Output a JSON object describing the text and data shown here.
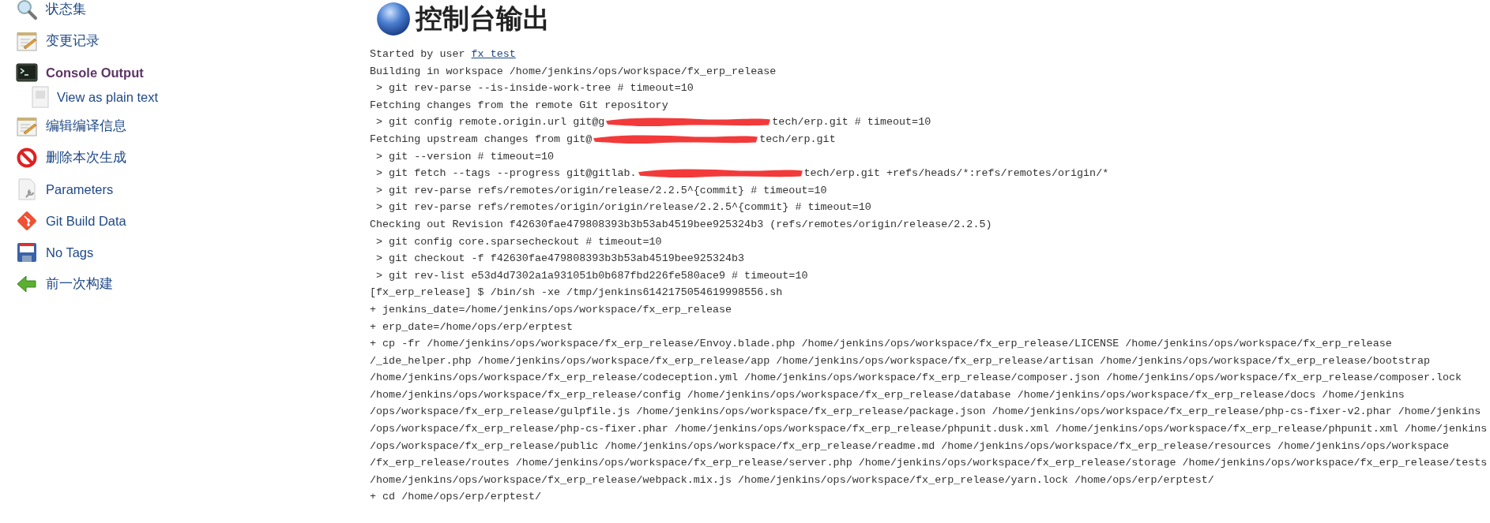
{
  "sidebar": {
    "items": [
      {
        "label": "状态集",
        "kind": "search",
        "selected": false
      },
      {
        "label": "变更记录",
        "kind": "notepad",
        "selected": false
      },
      {
        "label": "Console Output",
        "kind": "console",
        "selected": true,
        "children": [
          {
            "label": "View as plain text",
            "kind": "page",
            "selected": false
          }
        ]
      },
      {
        "label": "编辑编译信息",
        "kind": "notepad",
        "selected": false
      },
      {
        "label": "删除本次生成",
        "kind": "no-entry",
        "selected": false
      },
      {
        "label": "Parameters",
        "kind": "params",
        "selected": false
      },
      {
        "label": "Git Build Data",
        "kind": "git",
        "selected": false
      },
      {
        "label": "No Tags",
        "kind": "floppy",
        "selected": false
      },
      {
        "label": "前一次构建",
        "kind": "back",
        "selected": false
      }
    ]
  },
  "main": {
    "title": "控制台输出",
    "console_lines": [
      {
        "kind": "link",
        "text": "Started by user ",
        "link": "fx_test"
      },
      {
        "kind": "plain",
        "text": "Building in workspace /home/jenkins/ops/workspace/fx_erp_release"
      },
      {
        "kind": "plain",
        "text": " > git rev-parse --is-inside-work-tree # timeout=10"
      },
      {
        "kind": "plain",
        "text": "Fetching changes from the remote Git repository"
      },
      {
        "kind": "redacted",
        "text": " > git config remote.origin.url git@g",
        "after": "tech/erp.git # timeout=10"
      },
      {
        "kind": "redacted",
        "text": "Fetching upstream changes from git@",
        "after": "tech/erp.git"
      },
      {
        "kind": "plain",
        "text": " > git --version # timeout=10"
      },
      {
        "kind": "redacted",
        "text": " > git fetch --tags --progress git@gitlab.",
        "after": "tech/erp.git +refs/heads/*:refs/remotes/origin/*"
      },
      {
        "kind": "plain",
        "text": " > git rev-parse refs/remotes/origin/release/2.2.5^{commit} # timeout=10"
      },
      {
        "kind": "plain",
        "text": " > git rev-parse refs/remotes/origin/origin/release/2.2.5^{commit} # timeout=10"
      },
      {
        "kind": "plain",
        "text": "Checking out Revision f42630fae479808393b3b53ab4519bee925324b3 (refs/remotes/origin/release/2.2.5)"
      },
      {
        "kind": "plain",
        "text": " > git config core.sparsecheckout # timeout=10"
      },
      {
        "kind": "plain",
        "text": " > git checkout -f f42630fae479808393b3b53ab4519bee925324b3"
      },
      {
        "kind": "plain",
        "text": " > git rev-list e53d4d7302a1a931051b0b687fbd226fe580ace9 # timeout=10"
      },
      {
        "kind": "plain",
        "text": "[fx_erp_release] $ /bin/sh -xe /tmp/jenkins6142175054619998556.sh"
      },
      {
        "kind": "plain",
        "text": "+ jenkins_date=/home/jenkins/ops/workspace/fx_erp_release"
      },
      {
        "kind": "plain",
        "text": "+ erp_date=/home/ops/erp/erptest"
      },
      {
        "kind": "plain",
        "text": "+ cp -fr /home/jenkins/ops/workspace/fx_erp_release/Envoy.blade.php /home/jenkins/ops/workspace/fx_erp_release/LICENSE /home/jenkins/ops/workspace/fx_erp_release"
      },
      {
        "kind": "plain",
        "text": "/_ide_helper.php /home/jenkins/ops/workspace/fx_erp_release/app /home/jenkins/ops/workspace/fx_erp_release/artisan /home/jenkins/ops/workspace/fx_erp_release/bootstrap"
      },
      {
        "kind": "plain",
        "text": "/home/jenkins/ops/workspace/fx_erp_release/codeception.yml /home/jenkins/ops/workspace/fx_erp_release/composer.json /home/jenkins/ops/workspace/fx_erp_release/composer.lock"
      },
      {
        "kind": "plain",
        "text": "/home/jenkins/ops/workspace/fx_erp_release/config /home/jenkins/ops/workspace/fx_erp_release/database /home/jenkins/ops/workspace/fx_erp_release/docs /home/jenkins"
      },
      {
        "kind": "plain",
        "text": "/ops/workspace/fx_erp_release/gulpfile.js /home/jenkins/ops/workspace/fx_erp_release/package.json /home/jenkins/ops/workspace/fx_erp_release/php-cs-fixer-v2.phar /home/jenkins"
      },
      {
        "kind": "plain",
        "text": "/ops/workspace/fx_erp_release/php-cs-fixer.phar /home/jenkins/ops/workspace/fx_erp_release/phpunit.dusk.xml /home/jenkins/ops/workspace/fx_erp_release/phpunit.xml /home/jenkins"
      },
      {
        "kind": "plain",
        "text": "/ops/workspace/fx_erp_release/public /home/jenkins/ops/workspace/fx_erp_release/readme.md /home/jenkins/ops/workspace/fx_erp_release/resources /home/jenkins/ops/workspace"
      },
      {
        "kind": "plain",
        "text": "/fx_erp_release/routes /home/jenkins/ops/workspace/fx_erp_release/server.php /home/jenkins/ops/workspace/fx_erp_release/storage /home/jenkins/ops/workspace/fx_erp_release/tests"
      },
      {
        "kind": "plain",
        "text": "/home/jenkins/ops/workspace/fx_erp_release/webpack.mix.js /home/jenkins/ops/workspace/fx_erp_release/yarn.lock /home/ops/erp/erptest/"
      },
      {
        "kind": "plain",
        "text": "+ cd /home/ops/erp/erptest/"
      }
    ]
  }
}
